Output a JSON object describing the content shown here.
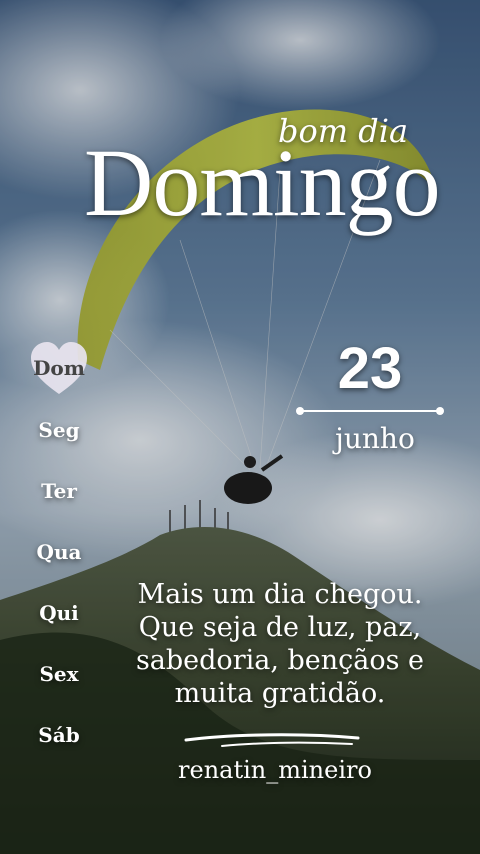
{
  "header": {
    "greeting": "bom dia",
    "title": "Domingo"
  },
  "weekdays": {
    "items": [
      {
        "label": "Dom",
        "active": true
      },
      {
        "label": "Seg",
        "active": false
      },
      {
        "label": "Ter",
        "active": false
      },
      {
        "label": "Qua",
        "active": false
      },
      {
        "label": "Qui",
        "active": false
      },
      {
        "label": "Sex",
        "active": false
      },
      {
        "label": "Sáb",
        "active": false
      }
    ]
  },
  "date": {
    "day": "23",
    "month": "junho"
  },
  "message": {
    "line1": "Mais um dia chegou.",
    "line2": "Que seja de luz, paz,",
    "line3": "sabedoria, bençãos e",
    "line4": "muita gratidão."
  },
  "signature": "renatin_mineiro",
  "colors": {
    "sky_top": "#3e5f86",
    "sky_mid": "#8aa0b6",
    "mountain": "#3f4a2e",
    "wing": "#b8c23a",
    "heart": "#e6e2ee",
    "text": "#ffffff"
  }
}
